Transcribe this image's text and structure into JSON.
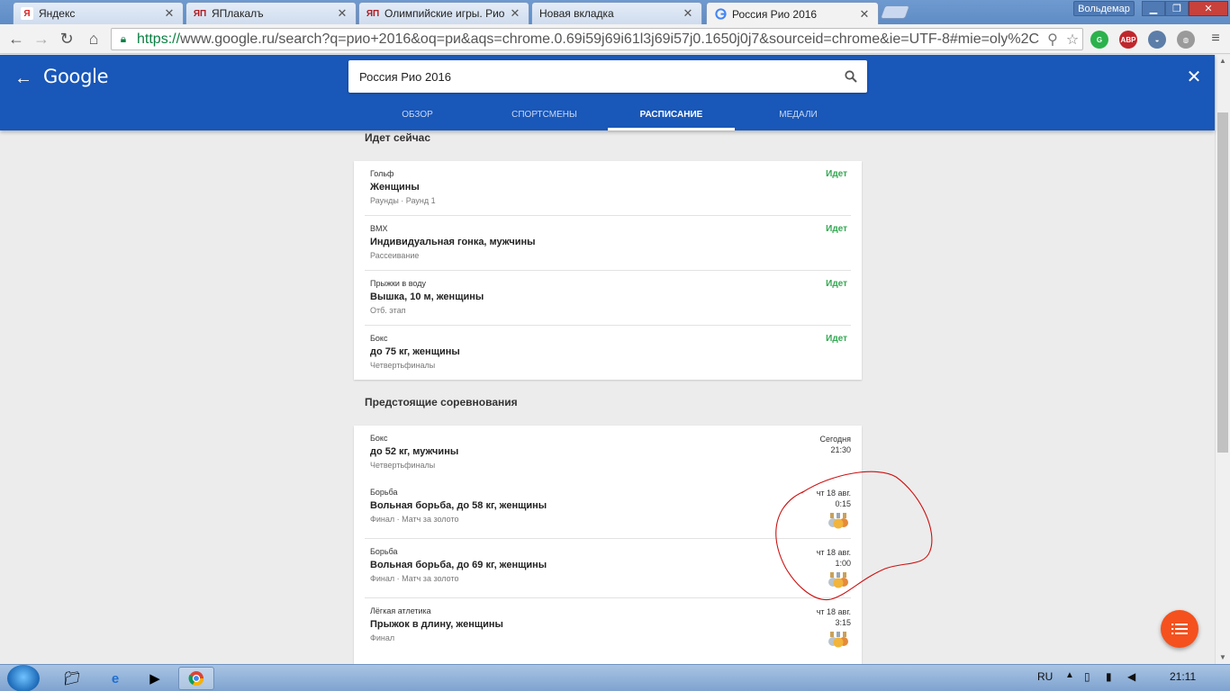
{
  "browser": {
    "tabs": [
      {
        "title": "Яндекс",
        "icon": "yandex-icon"
      },
      {
        "title": "ЯПлакалъ",
        "icon": "yaplakal-icon"
      },
      {
        "title": "Олимпийские игры. Рио",
        "icon": "yaplakal-icon"
      },
      {
        "title": "Новая вкладка",
        "icon": "none"
      },
      {
        "title": "Россия Рио 2016",
        "icon": "google-icon",
        "active": true
      }
    ],
    "user_name": "Вольдемар",
    "url_https": "https://",
    "url_rest": "www.google.ru/search?q=рио+2016&oq=ри&aqs=chrome.0.69i59j69i61l3j69i57j0.1650j0j7&sourceid=chrome&ie=UTF-8#mie=oly%2C",
    "ext_abp_label": "ABP"
  },
  "google": {
    "logo": "Google",
    "query": "Россия Рио 2016",
    "tabs": [
      {
        "label": "ОБЗОР"
      },
      {
        "label": "СПОРТСМЕНЫ"
      },
      {
        "label": "РАСПИСАНИЕ",
        "active": true
      },
      {
        "label": "МЕДАЛИ"
      }
    ]
  },
  "now": {
    "title": "Идет сейчас",
    "items": [
      {
        "sport": "Гольф",
        "event": "Женщины",
        "stage": "Раунды · Раунд 1",
        "status": "Идет"
      },
      {
        "sport": "BMX",
        "event": "Индивидуальная гонка, мужчины",
        "stage": "Рассеивание",
        "status": "Идет"
      },
      {
        "sport": "Прыжки в воду",
        "event": "Вышка, 10 м, женщины",
        "stage": "Отб. этап",
        "status": "Идет"
      },
      {
        "sport": "Бокс",
        "event": "до 75 кг, женщины",
        "stage": "Четвертьфиналы",
        "status": "Идет"
      }
    ]
  },
  "upcoming": {
    "title": "Предстоящие соревнования",
    "items": [
      {
        "sport": "Бокс",
        "event": "до 52 кг, мужчины",
        "stage": "Четвертьфиналы",
        "date": "Сегодня",
        "time": "21:30",
        "medal": false
      },
      {
        "sport": "Борьба",
        "event": "Вольная борьба, до 58 кг, женщины",
        "stage": "Финал · Матч за золото",
        "date": "чт 18 авг.",
        "time": "0:15",
        "medal": true
      },
      {
        "sport": "Борьба",
        "event": "Вольная борьба, до 69 кг, женщины",
        "stage": "Финал · Матч за золото",
        "date": "чт 18 авг.",
        "time": "1:00",
        "medal": true
      },
      {
        "sport": "Лёгкая атлетика",
        "event": "Прыжок в длину, женщины",
        "stage": "Финал",
        "date": "чт 18 авг.",
        "time": "3:15",
        "medal": true
      }
    ]
  },
  "taskbar": {
    "lang": "RU",
    "clock": "21:11"
  },
  "colors": {
    "header_blue": "#1957b8",
    "live_green": "#34a853",
    "fab_orange": "#f4511e",
    "annotation_red": "#cc1111"
  }
}
